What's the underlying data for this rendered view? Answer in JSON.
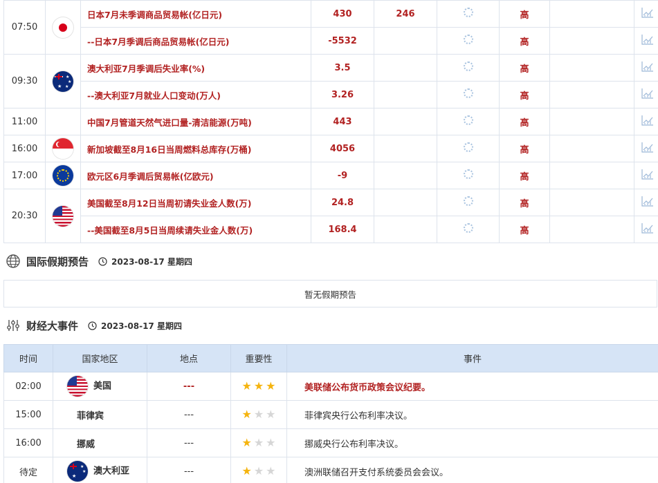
{
  "econ_rows": [
    {
      "time": "07:50",
      "flag": "japan-flag",
      "indicator": "日本7月未季调商品贸易帐(亿日元)",
      "previous": "430",
      "forecast": "246",
      "importance": "高"
    },
    {
      "time": "",
      "flag": "",
      "indicator": "--日本7月季调后商品贸易帐(亿日元)",
      "previous": "-5532",
      "forecast": "",
      "importance": "高"
    },
    {
      "time": "09:30",
      "flag": "australia-flag",
      "indicator": "澳大利亚7月季调后失业率(%)",
      "previous": "3.5",
      "forecast": "",
      "importance": "高"
    },
    {
      "time": "",
      "flag": "",
      "indicator": "--澳大利亚7月就业人口变动(万人)",
      "previous": "3.26",
      "forecast": "",
      "importance": "高"
    },
    {
      "time": "11:00",
      "flag": "",
      "indicator": "中国7月管道天然气进口量-清洁能源(万吨)",
      "previous": "443",
      "forecast": "",
      "importance": "高"
    },
    {
      "time": "16:00",
      "flag": "singapore-flag",
      "indicator": "新加坡截至8月16日当周燃料总库存(万桶)",
      "previous": "4056",
      "forecast": "",
      "importance": "高"
    },
    {
      "time": "17:00",
      "flag": "eu-flag",
      "indicator": "欧元区6月季调后贸易帐(亿欧元)",
      "previous": "-9",
      "forecast": "",
      "importance": "高"
    },
    {
      "time": "20:30",
      "flag": "usa-flag",
      "indicator": "美国截至8月12日当周初请失业金人数(万)",
      "previous": "24.8",
      "forecast": "",
      "importance": "高"
    },
    {
      "time": "",
      "flag": "",
      "indicator": "--美国截至8月5日当周续请失业金人数(万)",
      "previous": "168.4",
      "forecast": "",
      "importance": "高"
    }
  ],
  "holiday": {
    "title": "国际假期预告",
    "date": "2023-08-17 星期四",
    "empty_text": "暂无假期预告"
  },
  "events": {
    "title": "财经大事件",
    "date": "2023-08-17 星期四",
    "headers": [
      "时间",
      "国家地区",
      "地点",
      "重要性",
      "事件"
    ],
    "rows": [
      {
        "time": "02:00",
        "flag": "usa-flag",
        "country": "美国",
        "location": "---",
        "stars": 3,
        "event": "美联储公布货币政策会议纪要。",
        "highlight": true
      },
      {
        "time": "15:00",
        "flag": "",
        "country": "菲律宾",
        "location": "---",
        "stars": 1,
        "event": "菲律宾央行公布利率决议。",
        "highlight": false
      },
      {
        "time": "16:00",
        "flag": "",
        "country": "挪威",
        "location": "---",
        "stars": 1,
        "event": "挪威央行公布利率决议。",
        "highlight": false
      },
      {
        "time": "待定",
        "flag": "australia-flag",
        "country": "澳大利亚",
        "location": "---",
        "stars": 1,
        "event": "澳洲联储召开支付系统委员会会议。",
        "highlight": false
      }
    ]
  },
  "colors": {
    "accent_red": "#b22222",
    "header_blue": "#d6e4f6",
    "star_gold": "#f5b40f"
  }
}
